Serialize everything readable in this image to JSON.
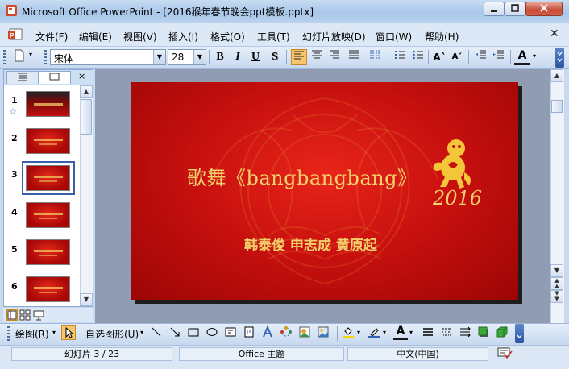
{
  "window": {
    "title": "Microsoft Office PowerPoint - [2016猴年春节晚会ppt模板.pptx]"
  },
  "menu": [
    "文件(F)",
    "编辑(E)",
    "视图(V)",
    "插入(I)",
    "格式(O)",
    "工具(T)",
    "幻灯片放映(D)",
    "窗口(W)",
    "帮助(H)"
  ],
  "toolbar": {
    "font_name": "宋体",
    "font_size": "28",
    "bold": "B",
    "italic": "I",
    "underline": "U",
    "shadow": "S",
    "grow_font": "A˄",
    "shrink_font": "A˅",
    "font_color": "A",
    "align_left_active": true
  },
  "left_panel": {
    "tabs": [
      "outline",
      "slides"
    ],
    "close": "×",
    "slides": [
      {
        "num": "1",
        "star": "☆"
      },
      {
        "num": "2"
      },
      {
        "num": "3",
        "selected": true
      },
      {
        "num": "4"
      },
      {
        "num": "5"
      },
      {
        "num": "6"
      }
    ]
  },
  "slide": {
    "title": "歌舞《bangbangbang》",
    "subtitle": "韩泰俊  申志成  黄原起",
    "year": "2016"
  },
  "drawing_toolbar": {
    "draw_label": "绘图(R)",
    "autoshapes_label": "自选图形(U)"
  },
  "status": {
    "slide_info": "幻灯片 3 / 23",
    "theme": "Office 主题",
    "language": "中文(中国)"
  },
  "colors": {
    "slide_red": "#c9110f",
    "title_gold": "#f3d06a",
    "chrome_blue": "#c6d8ef"
  }
}
